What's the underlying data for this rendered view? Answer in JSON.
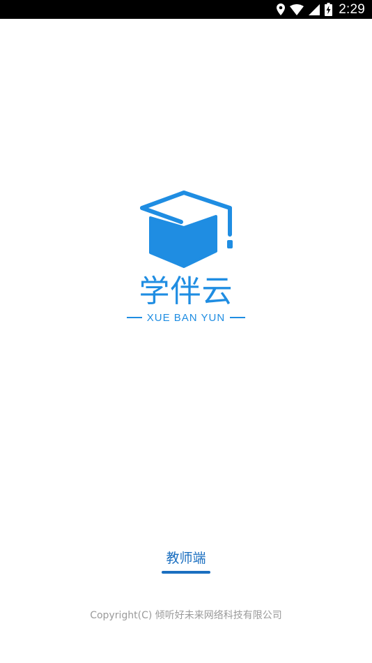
{
  "status_bar": {
    "time": "2:29",
    "icons": [
      "location-icon",
      "wifi-icon",
      "signal-icon",
      "battery-charging-icon"
    ]
  },
  "brand": {
    "logo_icon": "graduation-cap-icon",
    "name_cn": "学伴云",
    "name_en": "XUE BAN YUN",
    "color": "#1f8de2"
  },
  "role_tab": {
    "label": "教师端",
    "color": "#1b6fc0"
  },
  "footer": {
    "copyright": "Copyright(C)  倾听好未来网络科技有限公司"
  }
}
